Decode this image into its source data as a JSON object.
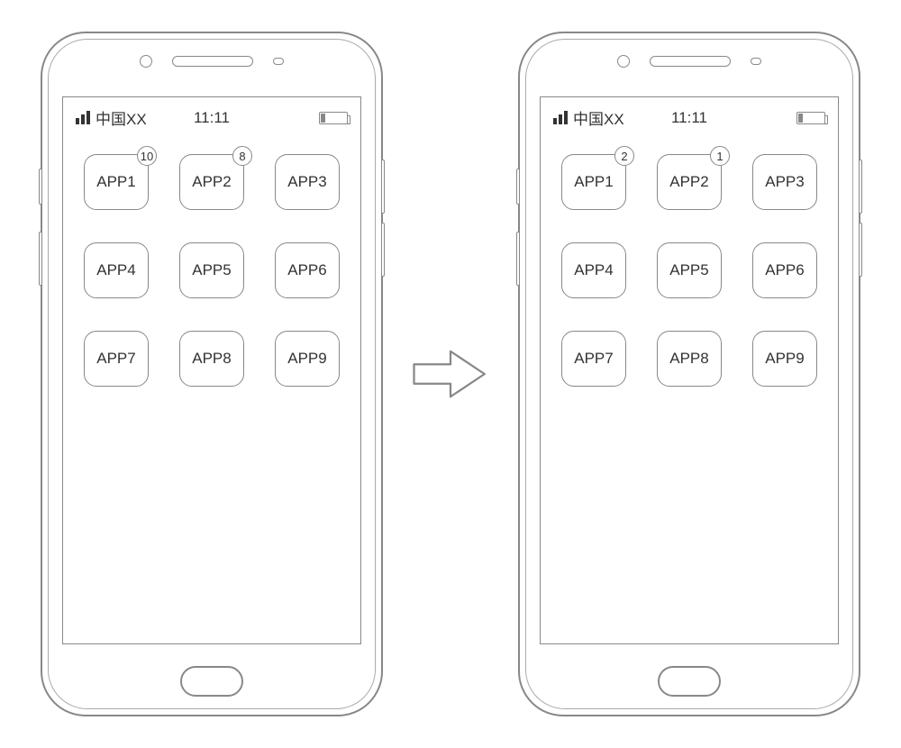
{
  "status": {
    "carrier": "中国XX",
    "time": "11:11"
  },
  "phones": [
    {
      "apps": [
        {
          "label": "APP1",
          "badge": "10"
        },
        {
          "label": "APP2",
          "badge": "8"
        },
        {
          "label": "APP3",
          "badge": null
        },
        {
          "label": "APP4",
          "badge": null
        },
        {
          "label": "APP5",
          "badge": null
        },
        {
          "label": "APP6",
          "badge": null
        },
        {
          "label": "APP7",
          "badge": null
        },
        {
          "label": "APP8",
          "badge": null
        },
        {
          "label": "APP9",
          "badge": null
        }
      ]
    },
    {
      "apps": [
        {
          "label": "APP1",
          "badge": "2"
        },
        {
          "label": "APP2",
          "badge": "1"
        },
        {
          "label": "APP3",
          "badge": null
        },
        {
          "label": "APP4",
          "badge": null
        },
        {
          "label": "APP5",
          "badge": null
        },
        {
          "label": "APP6",
          "badge": null
        },
        {
          "label": "APP7",
          "badge": null
        },
        {
          "label": "APP8",
          "badge": null
        },
        {
          "label": "APP9",
          "badge": null
        }
      ]
    }
  ]
}
